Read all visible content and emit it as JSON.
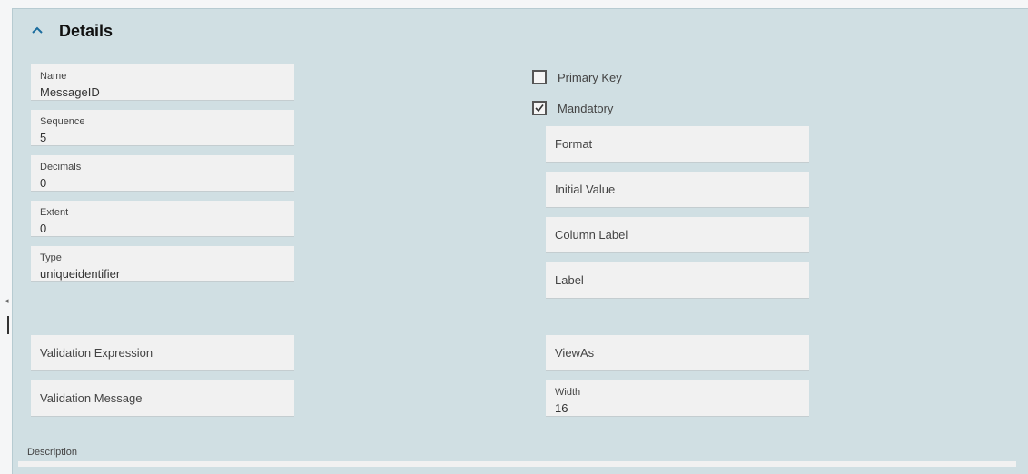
{
  "panel": {
    "title": "Details"
  },
  "left_fields": [
    {
      "label": "Name",
      "value": "MessageID"
    },
    {
      "label": "Sequence",
      "value": "5"
    },
    {
      "label": "Decimals",
      "value": "0"
    },
    {
      "label": "Extent",
      "value": "0"
    },
    {
      "label": "Type",
      "value": "uniqueidentifier"
    }
  ],
  "validation": {
    "expression_placeholder": "Validation Expression",
    "message_placeholder": "Validation Message"
  },
  "checkboxes": {
    "primary_key": {
      "label": "Primary Key",
      "checked": false
    },
    "mandatory": {
      "label": "Mandatory",
      "checked": true
    }
  },
  "right_fields": {
    "format_placeholder": "Format",
    "initial_value_placeholder": "Initial Value",
    "column_label_placeholder": "Column Label",
    "label_placeholder": "Label",
    "viewas_placeholder": "ViewAs",
    "width": {
      "label": "Width",
      "value": "16"
    }
  },
  "description": {
    "label": "Description"
  },
  "icons": {
    "collapse": "chevron-up-icon",
    "check": "checkmark-icon"
  },
  "colors": {
    "panel_bg": "#d0dfe3",
    "chevron": "#1b6c9e",
    "field_bg": "#f1f1f1"
  }
}
